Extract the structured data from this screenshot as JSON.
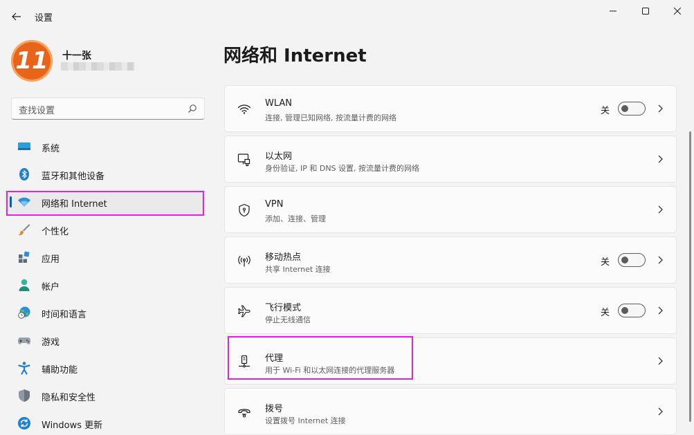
{
  "window": {
    "title": "设置",
    "back_icon": "arrow-left-icon",
    "controls": [
      "minimize-icon",
      "maximize-icon",
      "close-icon"
    ]
  },
  "profile": {
    "name": "十一张",
    "avatar_text": "11"
  },
  "search": {
    "placeholder": "查找设置"
  },
  "nav": {
    "items": [
      {
        "label": "系统",
        "icon": "system-icon"
      },
      {
        "label": "蓝牙和其他设备",
        "icon": "bluetooth-icon"
      },
      {
        "label": "网络和 Internet",
        "icon": "wifi-icon",
        "active": true
      },
      {
        "label": "个性化",
        "icon": "brush-icon"
      },
      {
        "label": "应用",
        "icon": "apps-icon"
      },
      {
        "label": "帐户",
        "icon": "account-icon"
      },
      {
        "label": "时间和语言",
        "icon": "globe-clock-icon"
      },
      {
        "label": "游戏",
        "icon": "gamepad-icon"
      },
      {
        "label": "辅助功能",
        "icon": "accessibility-icon"
      },
      {
        "label": "隐私和安全性",
        "icon": "shield-icon"
      },
      {
        "label": "Windows 更新",
        "icon": "update-icon"
      }
    ]
  },
  "main": {
    "title": "网络和 Internet",
    "cards": [
      {
        "title": "WLAN",
        "subtitle": "连接, 管理已知网络, 按流量计费的网络",
        "icon": "wifi-outline-icon",
        "toggle_label": "关",
        "toggle_on": false
      },
      {
        "title": "以太网",
        "subtitle": "身份验证, IP 和 DNS 设置, 按流量计费的网络",
        "icon": "ethernet-icon"
      },
      {
        "title": "VPN",
        "subtitle": "添加、连接、管理",
        "icon": "vpn-shield-icon"
      },
      {
        "title": "移动热点",
        "subtitle": "共享 Internet 连接",
        "icon": "hotspot-icon",
        "toggle_label": "关",
        "toggle_on": false
      },
      {
        "title": "飞行模式",
        "subtitle": "停止无线通信",
        "icon": "airplane-icon",
        "toggle_label": "关",
        "toggle_on": false
      },
      {
        "title": "代理",
        "subtitle": "用于 Wi-Fi 和以太网连接的代理服务器",
        "icon": "proxy-icon"
      },
      {
        "title": "拨号",
        "subtitle": "设置拨号 Internet 连接",
        "icon": "dialup-icon"
      }
    ]
  },
  "colors": {
    "accent": "#005fb8",
    "highlight": "#e81ee0",
    "avatar": "#e8641b"
  }
}
